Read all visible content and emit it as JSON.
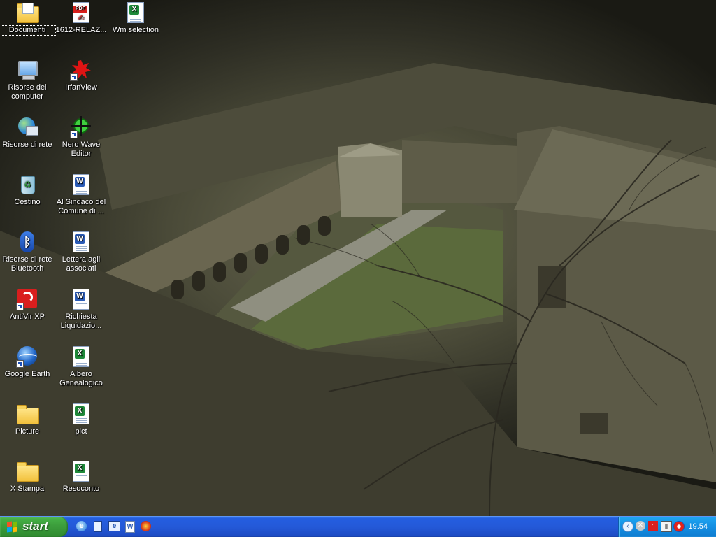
{
  "desktop": {
    "icons": [
      {
        "label": "Documenti"
      },
      {
        "label": "1612-RELAZ..."
      },
      {
        "label": "Wm selection"
      },
      {
        "label": "Risorse del computer"
      },
      {
        "label": "IrfanView"
      },
      {
        "label": "Risorse di rete"
      },
      {
        "label": "Nero Wave Editor"
      },
      {
        "label": "Cestino"
      },
      {
        "label": "Al Sindaco del Comune di ..."
      },
      {
        "label": "Risorse di rete Bluetooth"
      },
      {
        "label": "Lettera agli associati"
      },
      {
        "label": "AntiVir XP"
      },
      {
        "label": "Richiesta Liquidazio..."
      },
      {
        "label": "Google Earth"
      },
      {
        "label": "Albero Genealogico"
      },
      {
        "label": "Picture"
      },
      {
        "label": "pict"
      },
      {
        "label": "X Stampa"
      },
      {
        "label": "Resoconto"
      }
    ]
  },
  "taskbar": {
    "start_label": "start",
    "clock": "19.54"
  },
  "colors": {
    "taskbar": "#245ee0",
    "start_green": "#3c9d3c",
    "tray": "#138ee2"
  }
}
